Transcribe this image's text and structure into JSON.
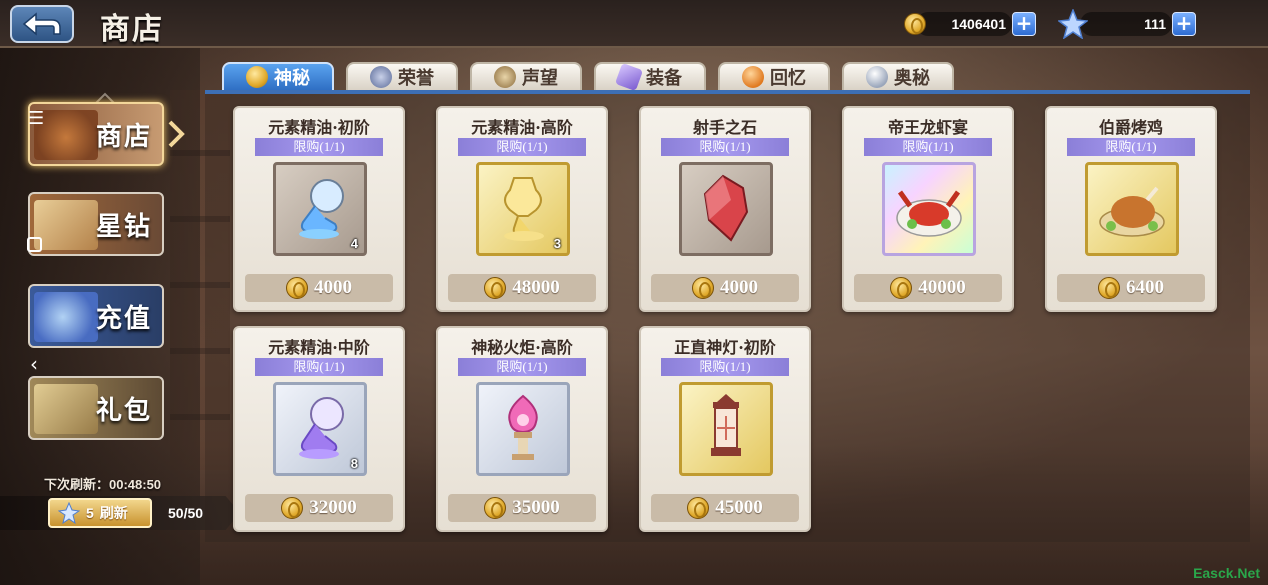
{
  "header": {
    "title": "商店",
    "coins": "1406401",
    "stars": "111"
  },
  "nav": {
    "items": [
      {
        "label": "商店"
      },
      {
        "label": "星钻"
      },
      {
        "label": "充值"
      },
      {
        "label": "礼包"
      }
    ],
    "refresh_label": "下次刷新：00:48:50",
    "refresh_cost": "5",
    "refresh_button": "刷新",
    "refresh_count": "50/50"
  },
  "tabs": [
    {
      "label": "神秘",
      "active": true
    },
    {
      "label": "荣誉"
    },
    {
      "label": "声望"
    },
    {
      "label": "装备"
    },
    {
      "label": "回忆"
    },
    {
      "label": "奥秘"
    }
  ],
  "items": [
    {
      "name": "元素精油·初阶",
      "limit": "限购(1/1)",
      "qty": "4",
      "price": "4000",
      "frame": "bronze",
      "art": "oil-blue"
    },
    {
      "name": "元素精油·高阶",
      "limit": "限购(1/1)",
      "qty": "3",
      "price": "48000",
      "frame": "gold",
      "art": "oil-gold"
    },
    {
      "name": "射手之石",
      "limit": "限购(1/1)",
      "qty": "",
      "price": "4000",
      "frame": "bronze",
      "art": "stone-red"
    },
    {
      "name": "帝王龙虾宴",
      "limit": "限购(1/1)",
      "qty": "",
      "price": "40000",
      "frame": "rainbow",
      "art": "lobster"
    },
    {
      "name": "伯爵烤鸡",
      "limit": "限购(1/1)",
      "qty": "",
      "price": "6400",
      "frame": "gold",
      "art": "chicken"
    },
    {
      "name": "元素精油·中阶",
      "limit": "限购(1/1)",
      "qty": "8",
      "price": "32000",
      "frame": "silver",
      "art": "oil-purple"
    },
    {
      "name": "神秘火炬·高阶",
      "limit": "限购(1/1)",
      "qty": "",
      "price": "35000",
      "frame": "silver",
      "art": "torch"
    },
    {
      "name": "正直神灯·初阶",
      "limit": "限购(1/1)",
      "qty": "",
      "price": "45000",
      "frame": "gold",
      "art": "lantern"
    }
  ],
  "watermark": "Easck.Net",
  "colors": {
    "accent_tab": "#2f6fc4",
    "limit_bar": "#a598ee",
    "price_bg": "#c9bba8"
  }
}
